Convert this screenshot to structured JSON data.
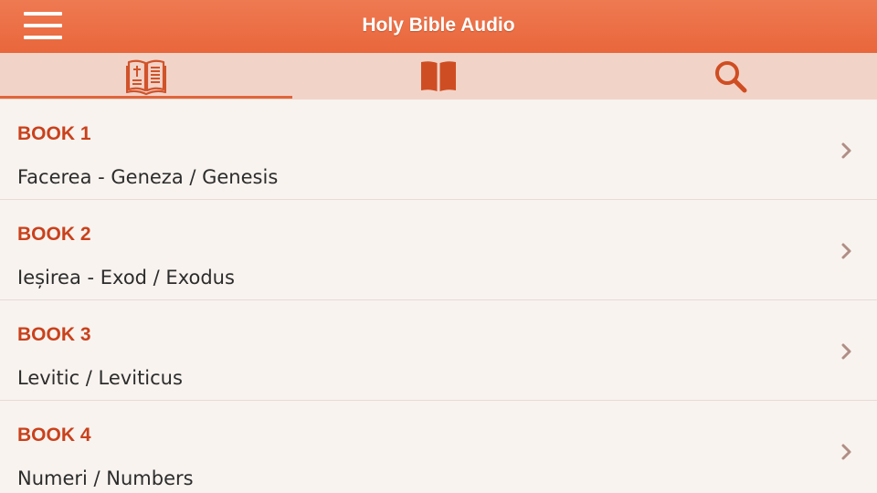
{
  "header": {
    "title": "Holy Bible Audio",
    "menu_icon": "hamburger-menu-icon"
  },
  "tabs": [
    {
      "icon": "open-bible-icon",
      "selected": true
    },
    {
      "icon": "closed-book-icon",
      "selected": false
    },
    {
      "icon": "search-icon",
      "selected": false
    }
  ],
  "books": [
    {
      "title": "BOOK 1",
      "name": "Facerea - Geneza / Genesis"
    },
    {
      "title": "BOOK 2",
      "name": "Ieșirea - Exod / Exodus"
    },
    {
      "title": "BOOK 3",
      "name": "Levitic / Leviticus"
    },
    {
      "title": "BOOK 4",
      "name": "Numeri / Numbers"
    }
  ],
  "colors": {
    "header": "#ec6f45",
    "tab_bar": "#f2d3c8",
    "accent": "#c9411c",
    "background": "#f8f3ef"
  }
}
